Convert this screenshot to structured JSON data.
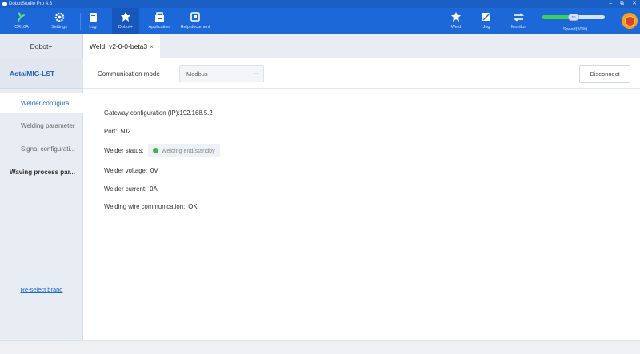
{
  "window": {
    "title": "DobotStudio Pro 4.3",
    "controls": {
      "minimize": "–",
      "restore": "⧉",
      "close": "✕"
    }
  },
  "toolbar": {
    "items": [
      {
        "label": "CR10A",
        "icon": "robot-arm-icon"
      },
      {
        "label": "Settings",
        "icon": "gear-icon"
      },
      {
        "label": "Log",
        "icon": "log-icon"
      },
      {
        "label": "Dobot+",
        "icon": "dobot-plus-icon"
      },
      {
        "label": "Application",
        "icon": "application-icon"
      },
      {
        "label": "Help document",
        "icon": "help-document-icon"
      },
      {
        "label": "Weld",
        "icon": "weld-icon"
      },
      {
        "label": "Jog",
        "icon": "jog-icon"
      },
      {
        "label": "Monitor",
        "icon": "monitor-icon"
      }
    ],
    "speed": {
      "label": "Speed(50%)",
      "value_percent": 50,
      "knob_text": "50"
    }
  },
  "tabs": {
    "left_label": "Dobot+",
    "active_tab": {
      "label": "Weld_v2-0-0-beta3",
      "close": "×"
    }
  },
  "sidebar": {
    "brand": "AotaiMIG-LST",
    "items": [
      {
        "label": "Welder configura..."
      },
      {
        "label": "Welding parameter"
      },
      {
        "label": "Signal configurati..."
      },
      {
        "label": "Waving process par..."
      }
    ],
    "reselect": "Re-select brand"
  },
  "content": {
    "comm_label": "Communication mode",
    "comm_value": "Modbus",
    "disconnect": "Disconnect",
    "gateway_label": "Gateway configuration (IP):",
    "gateway_value": "192.168.5.2",
    "port_label": "Port:",
    "port_value": "502",
    "status_label": "Welder status:",
    "status_value": "Welding end/standby",
    "voltage_label": "Welder voltage:",
    "voltage_value": "0V",
    "current_label": "Welder current:",
    "current_value": "0A",
    "wire_label": "Welding wire communication:",
    "wire_value": "OK"
  },
  "colors": {
    "accent": "#1d68d8",
    "status_ok": "#3cb84a",
    "speed_fill": "#3ed15a"
  }
}
